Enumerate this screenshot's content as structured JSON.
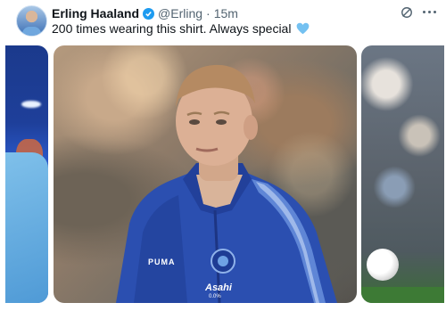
{
  "tweet": {
    "display_name": "Erling Haaland",
    "handle": "@Erling",
    "separator": "·",
    "time": "15m",
    "text": "200 times wearing this shirt. Always special",
    "emoji_icon": "light-blue-heart-icon",
    "verified_color": "#1d9bf0"
  },
  "media": {
    "count": 3,
    "jersey_print": {
      "brand": "PUMA",
      "sponsor": "Asahi",
      "sponsor_sub": "0.0%"
    }
  },
  "icons": [
    "verified-badge-icon",
    "grok-icon",
    "more-options-icon",
    "light-blue-heart-icon"
  ]
}
